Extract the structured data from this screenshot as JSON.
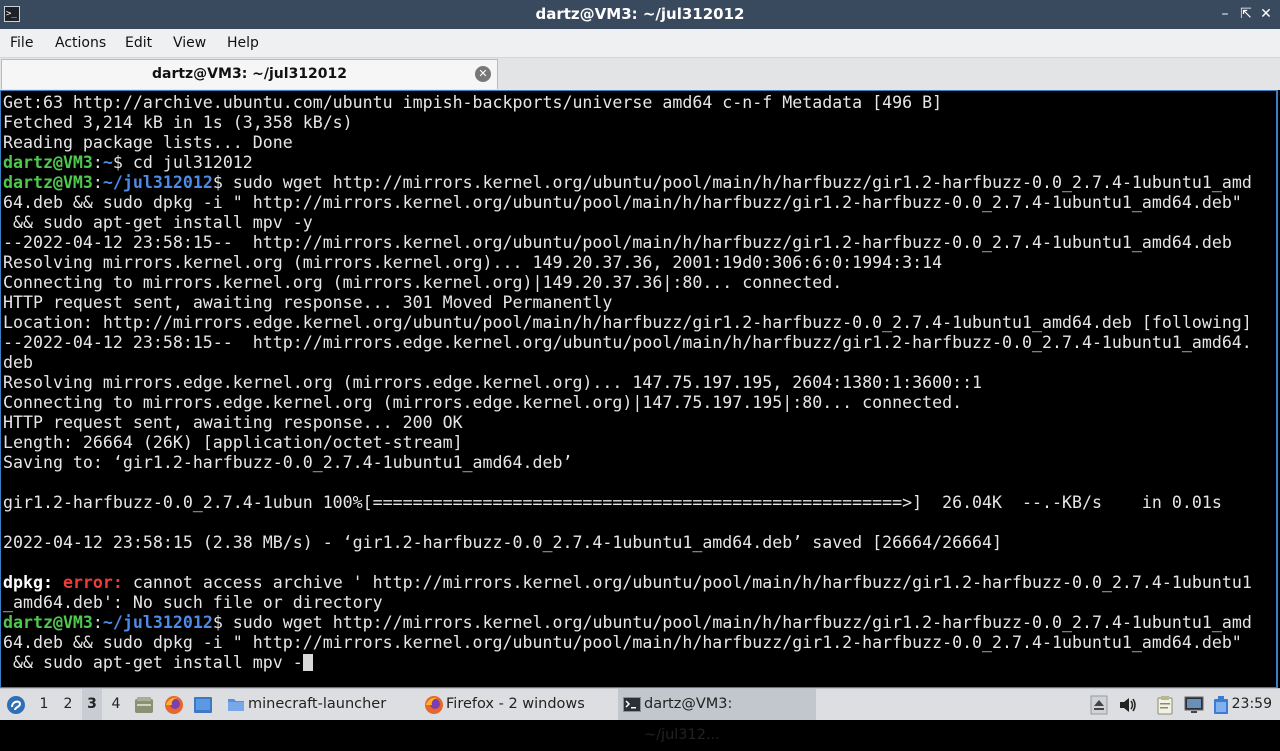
{
  "window": {
    "title": "dartz@VM3: ~/jul312012",
    "app_icon_text": ">_",
    "minimize_glyph": "–",
    "maximize_glyph": "⇱",
    "close_glyph": "✕"
  },
  "menu": [
    "File",
    "Actions",
    "Edit",
    "View",
    "Help"
  ],
  "tab": {
    "label": "dartz@VM3: ~/jul312012",
    "close_glyph": "✕"
  },
  "terminal": {
    "lines": [
      [
        {
          "t": "Get:63 http://archive.ubuntu.com/ubuntu impish-backports/universe amd64 c-n-f Metadata [496 B]"
        }
      ],
      [
        {
          "t": "Fetched 3,214 kB in 1s (3,358 kB/s)"
        }
      ],
      [
        {
          "t": "Reading package lists... Done"
        }
      ],
      [
        {
          "t": "dartz@VM3",
          "c": "user"
        },
        {
          "t": ":"
        },
        {
          "t": "~",
          "c": "path"
        },
        {
          "t": "$ cd jul312012"
        }
      ],
      [
        {
          "t": "dartz@VM3",
          "c": "user"
        },
        {
          "t": ":"
        },
        {
          "t": "~/jul312012",
          "c": "path"
        },
        {
          "t": "$ sudo wget http://mirrors.kernel.org/ubuntu/pool/main/h/harfbuzz/gir1.2-harfbuzz-0.0_2.7.4-1ubuntu1_amd"
        }
      ],
      [
        {
          "t": "64.deb && sudo dpkg -i \" http://mirrors.kernel.org/ubuntu/pool/main/h/harfbuzz/gir1.2-harfbuzz-0.0_2.7.4-1ubuntu1_amd64.deb\""
        }
      ],
      [
        {
          "t": " && sudo apt-get install mpv -y"
        }
      ],
      [
        {
          "t": "--2022-04-12 23:58:15--  http://mirrors.kernel.org/ubuntu/pool/main/h/harfbuzz/gir1.2-harfbuzz-0.0_2.7.4-1ubuntu1_amd64.deb"
        }
      ],
      [
        {
          "t": "Resolving mirrors.kernel.org (mirrors.kernel.org)... 149.20.37.36, 2001:19d0:306:6:0:1994:3:14"
        }
      ],
      [
        {
          "t": "Connecting to mirrors.kernel.org (mirrors.kernel.org)|149.20.37.36|:80... connected."
        }
      ],
      [
        {
          "t": "HTTP request sent, awaiting response... 301 Moved Permanently"
        }
      ],
      [
        {
          "t": "Location: http://mirrors.edge.kernel.org/ubuntu/pool/main/h/harfbuzz/gir1.2-harfbuzz-0.0_2.7.4-1ubuntu1_amd64.deb [following]"
        }
      ],
      [
        {
          "t": "--2022-04-12 23:58:15--  http://mirrors.edge.kernel.org/ubuntu/pool/main/h/harfbuzz/gir1.2-harfbuzz-0.0_2.7.4-1ubuntu1_amd64."
        }
      ],
      [
        {
          "t": "deb"
        }
      ],
      [
        {
          "t": "Resolving mirrors.edge.kernel.org (mirrors.edge.kernel.org)... 147.75.197.195, 2604:1380:1:3600::1"
        }
      ],
      [
        {
          "t": "Connecting to mirrors.edge.kernel.org (mirrors.edge.kernel.org)|147.75.197.195|:80... connected."
        }
      ],
      [
        {
          "t": "HTTP request sent, awaiting response... 200 OK"
        }
      ],
      [
        {
          "t": "Length: 26664 (26K) [application/octet-stream]"
        }
      ],
      [
        {
          "t": "Saving to: ‘gir1.2-harfbuzz-0.0_2.7.4-1ubuntu1_amd64.deb’"
        }
      ],
      [
        {
          "t": ""
        }
      ],
      [
        {
          "t": "gir1.2-harfbuzz-0.0_2.7.4-1ubun 100%[=====================================================>]  26.04K  --.-KB/s    in 0.01s"
        }
      ],
      [
        {
          "t": ""
        }
      ],
      [
        {
          "t": "2022-04-12 23:58:15 (2.38 MB/s) - ‘gir1.2-harfbuzz-0.0_2.7.4-1ubuntu1_amd64.deb’ saved [26664/26664]"
        }
      ],
      [
        {
          "t": ""
        }
      ],
      [
        {
          "t": "dpkg:",
          "c": "bold"
        },
        {
          "t": " "
        },
        {
          "t": "error:",
          "c": "err"
        },
        {
          "t": " cannot access archive ' http://mirrors.kernel.org/ubuntu/pool/main/h/harfbuzz/gir1.2-harfbuzz-0.0_2.7.4-1ubuntu1"
        }
      ],
      [
        {
          "t": "_amd64.deb': No such file or directory"
        }
      ],
      [
        {
          "t": "dartz@VM3",
          "c": "user"
        },
        {
          "t": ":"
        },
        {
          "t": "~/jul312012",
          "c": "path"
        },
        {
          "t": "$ sudo wget http://mirrors.kernel.org/ubuntu/pool/main/h/harfbuzz/gir1.2-harfbuzz-0.0_2.7.4-1ubuntu1_amd"
        }
      ],
      [
        {
          "t": "64.deb && sudo dpkg -i \" http://mirrors.kernel.org/ubuntu/pool/main/h/harfbuzz/gir1.2-harfbuzz-0.0_2.7.4-1ubuntu1_amd64.deb\""
        }
      ],
      [
        {
          "t": " && sudo apt-get install mpv -"
        }
      ]
    ]
  },
  "taskbar": {
    "workspaces": [
      {
        "label": "1",
        "active": false
      },
      {
        "label": "2",
        "active": false
      },
      {
        "label": "3",
        "active": true
      },
      {
        "label": "4",
        "active": false
      }
    ],
    "tasks": [
      {
        "label": "minecraft-launcher",
        "icon": "folder-icon",
        "active": false
      },
      {
        "label": "Firefox - 2 windows",
        "icon": "firefox-icon",
        "active": false
      },
      {
        "label": "dartz@VM3: ~/jul312...",
        "icon": "terminal-icon",
        "active": true
      }
    ],
    "clock": "23:59",
    "colors": {
      "accent": "#3b80c4",
      "prompt_user": "#4ec94e",
      "prompt_path": "#4d8be8",
      "error": "#ef3b3b"
    }
  }
}
